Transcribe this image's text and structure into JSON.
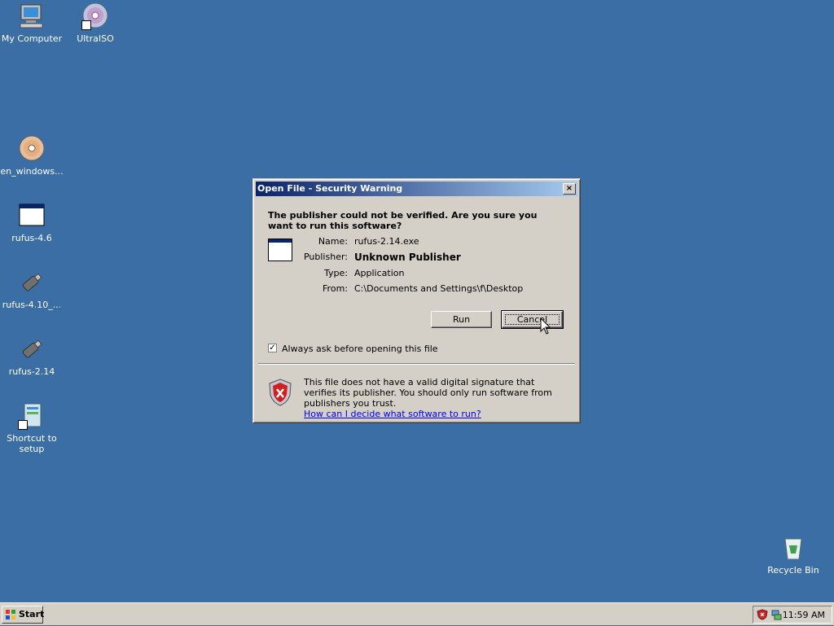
{
  "desktop": {
    "icons": [
      {
        "label": "My Computer",
        "icon": "computer-icon"
      },
      {
        "label": "UltraISO",
        "icon": "disc-icon"
      },
      {
        "label": "en_windows...",
        "icon": "disc-icon"
      },
      {
        "label": "rufus-4.6",
        "icon": "application-window-icon"
      },
      {
        "label": "rufus-4.10_...",
        "icon": "usb-drive-icon"
      },
      {
        "label": "rufus-2.14",
        "icon": "usb-drive-icon"
      },
      {
        "label": "Shortcut to setup",
        "icon": "setup-shortcut-icon"
      },
      {
        "label": "Recycle Bin",
        "icon": "recycle-bin-icon"
      }
    ]
  },
  "dialog": {
    "title": "Open File - Security Warning",
    "close_label": "×",
    "question": "The publisher could not be verified.  Are you sure you want to run this software?",
    "fields": {
      "name_label": "Name:",
      "name_value": "rufus-2.14.exe",
      "publisher_label": "Publisher:",
      "publisher_value": "Unknown Publisher",
      "type_label": "Type:",
      "type_value": "Application",
      "from_label": "From:",
      "from_value": "C:\\Documents and Settings\\f\\Desktop"
    },
    "run_label": "Run",
    "cancel_label": "Cancel",
    "checkbox_checked": true,
    "checkbox_mark": "✓",
    "checkbox_label": "Always ask before opening this file",
    "warning_text": "This file does not have a valid digital signature that verifies its publisher.  You should only run software from publishers you trust.",
    "help_link": "How can I decide what software to run?"
  },
  "taskbar": {
    "start_label": "Start",
    "clock": "11:59 AM"
  },
  "colors": {
    "desktop": "#3a6ea5",
    "titlebar_start": "#0a246a",
    "titlebar_end": "#a6caf0",
    "face": "#d4d0c8"
  }
}
